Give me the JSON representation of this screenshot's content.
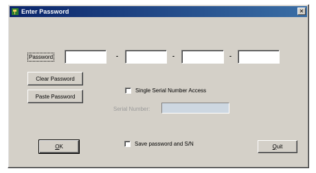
{
  "window": {
    "title": "Enter Password",
    "close_glyph": "✕",
    "icon": "key-icon"
  },
  "password": {
    "label": "Password",
    "separator": "-"
  },
  "buttons": {
    "clear_password": "Clear Password",
    "paste_password": "Paste Password",
    "ok_accel": "O",
    "ok_rest": "K",
    "quit_accel": "Q",
    "quit_rest": "uit"
  },
  "options": {
    "single_serial_label": "Single Serial Number Access",
    "serial_number_label": "Serial Number:",
    "save_password_label": "Save password and S/N"
  }
}
